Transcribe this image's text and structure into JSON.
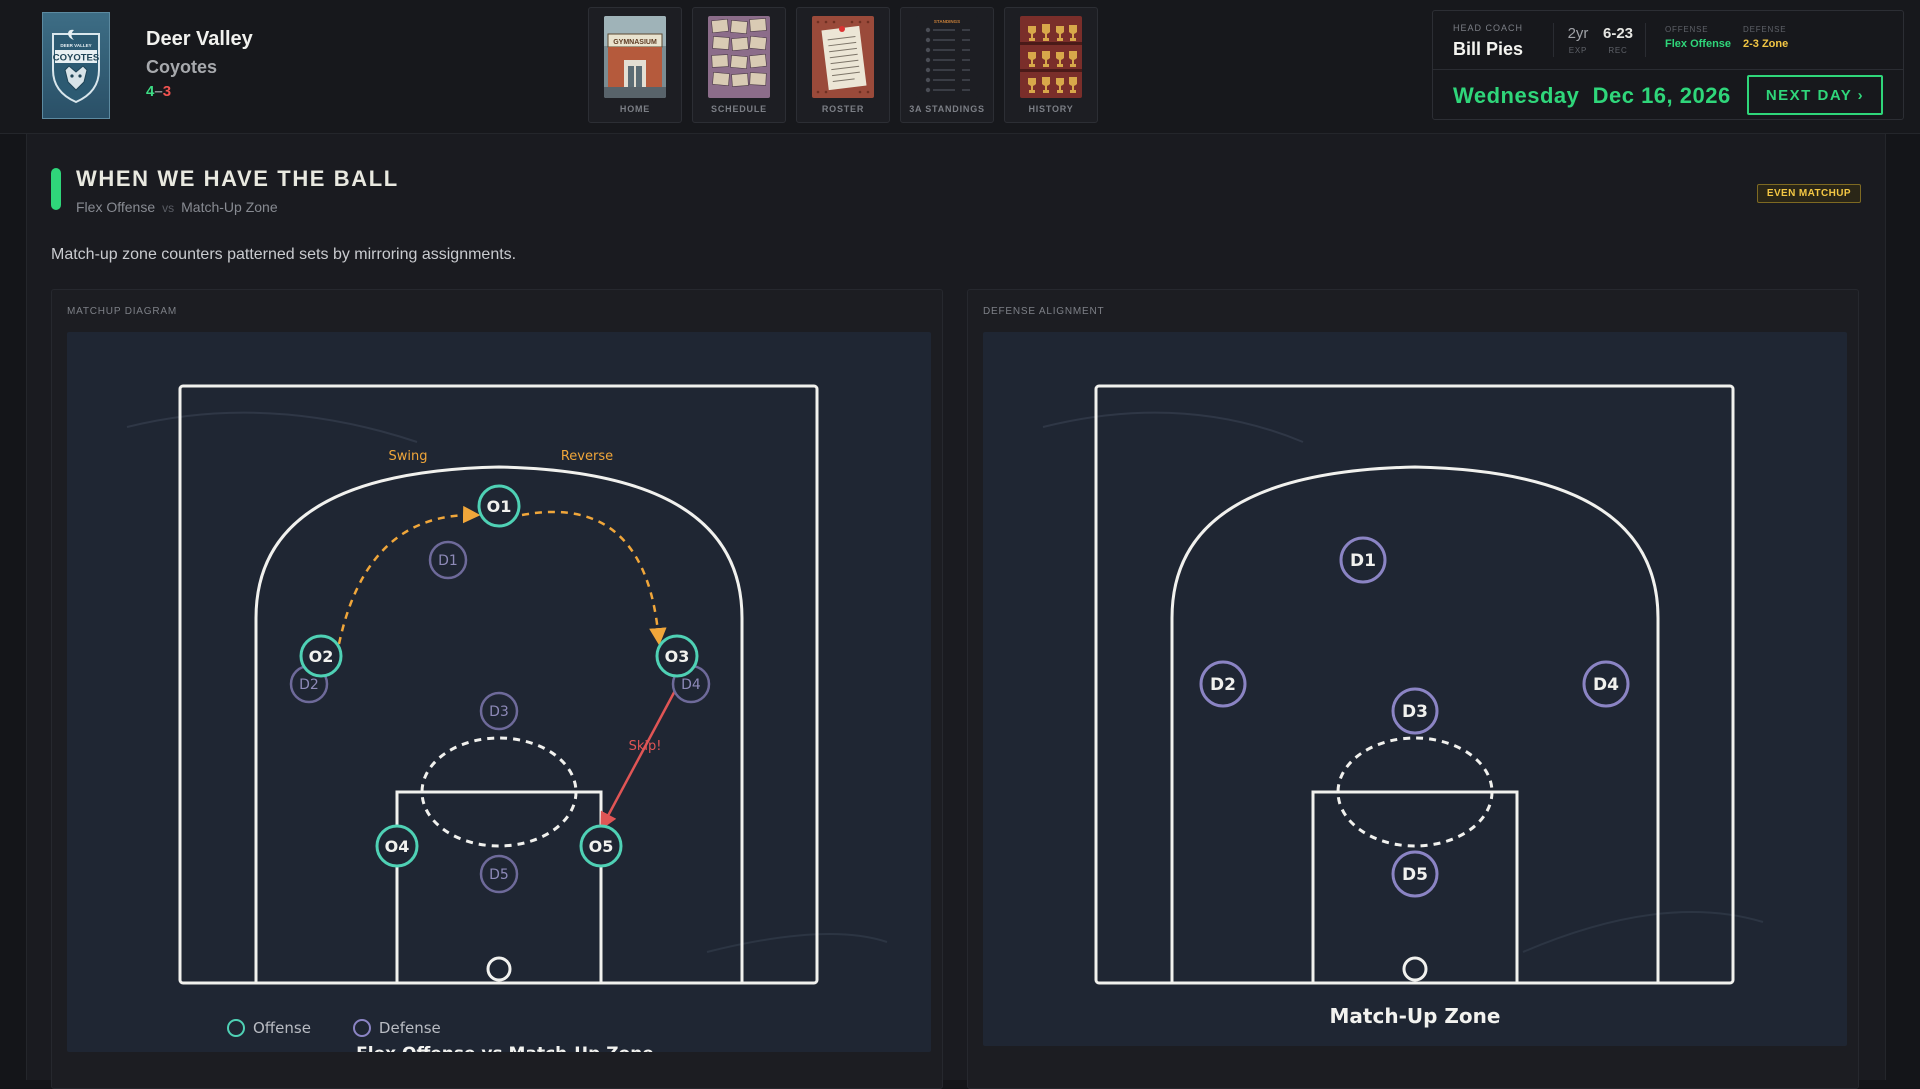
{
  "team": {
    "name": "Deer Valley",
    "mascot": "Coyotes",
    "wins": "4",
    "losses": "3",
    "logo_text": "COYOTES",
    "logo_sub": "DEER VALLEY"
  },
  "nav": [
    {
      "label": "HOME",
      "icon": "gymnasium-icon",
      "thumb_text": "GYMNASIUM"
    },
    {
      "label": "SCHEDULE",
      "icon": "schedule-board-icon"
    },
    {
      "label": "ROSTER",
      "icon": "clipboard-icon"
    },
    {
      "label": "3A STANDINGS",
      "icon": "standings-icon",
      "thumb_text": "STANDINGS"
    },
    {
      "label": "HISTORY",
      "icon": "trophy-case-icon"
    }
  ],
  "coach": {
    "label": "HEAD COACH",
    "name": "Bill Pies",
    "exp_value": "2yr",
    "exp_label": "EXP",
    "rec_value": "6-23",
    "rec_label": "REC",
    "offense_label": "OFFENSE",
    "offense_value": "Flex Offense",
    "defense_label": "DEFENSE",
    "defense_value": "2-3 Zone"
  },
  "date": {
    "weekday": "Wednesday",
    "date": "Dec 16, 2026",
    "next_label": "NEXT DAY ›"
  },
  "section": {
    "title": "WHEN WE HAVE THE BALL",
    "offense": "Flex Offense",
    "vs": "vs",
    "defense": "Match-Up Zone",
    "badge": "EVEN MATCHUP",
    "description": "Match-up zone counters patterned sets by mirroring assignments."
  },
  "matchup_card": {
    "label": "MATCHUP DIAGRAM",
    "legend_offense": "Offense",
    "legend_defense": "Defense",
    "caption": "Flex Offense vs Match-Up Zone",
    "annotations": {
      "swing": "Swing",
      "reverse": "Reverse",
      "skip": "Skip!"
    },
    "offense_players": [
      "O1",
      "O2",
      "O3",
      "O4",
      "O5"
    ],
    "defense_players": [
      "D1",
      "D2",
      "D3",
      "D4",
      "D5"
    ]
  },
  "alignment_card": {
    "label": "DEFENSE ALIGNMENT",
    "caption": "Match-Up Zone",
    "defense_players": [
      "D1",
      "D2",
      "D3",
      "D4",
      "D5"
    ]
  },
  "colors": {
    "accent": "#2fd67a",
    "offense": "#4fd1b5",
    "defense": "#8b84c4",
    "pass": "#f0a63a",
    "skip": "#e05555",
    "defense_value": "#f3c744"
  }
}
